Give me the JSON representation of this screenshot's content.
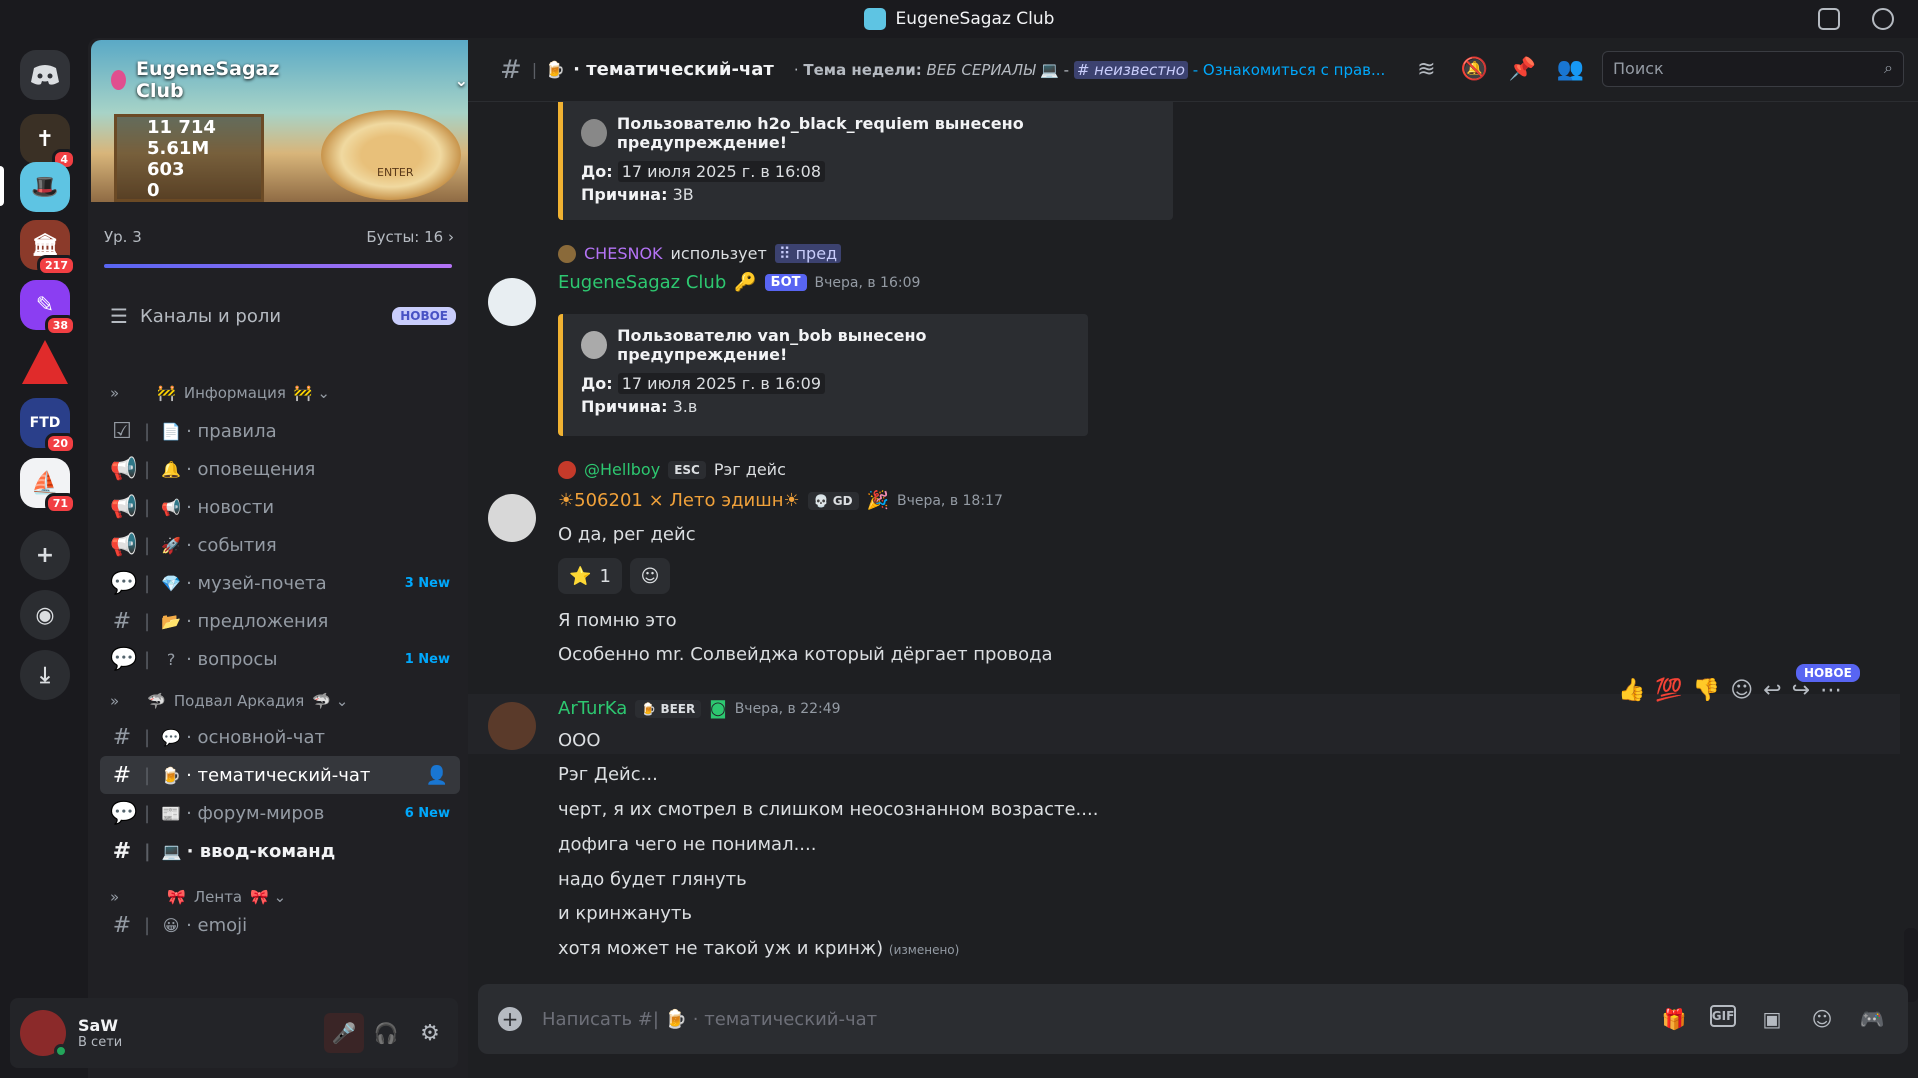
{
  "window": {
    "title": "EugeneSagaz Club"
  },
  "guilds": [
    {
      "badge": "4"
    },
    {
      "badge": ""
    },
    {
      "badge": "217"
    },
    {
      "badge": "38"
    },
    {
      "badge": ""
    },
    {
      "badge": "20"
    },
    {
      "badge": "71"
    }
  ],
  "server": {
    "name": "EugeneSagaz Club",
    "stats": [
      "11 714",
      "5.61M",
      "603",
      "0"
    ],
    "enter": "ENTER",
    "level": "Ур. 3",
    "boosts": "Бусты: 16",
    "channels_roles": "Каналы и роли",
    "new_label": "НОВОЕ"
  },
  "categories": [
    "Информация",
    "Подвал Аркадия",
    "Лента"
  ],
  "channels": [
    {
      "name": "правила",
      "emoji": "📄",
      "new": ""
    },
    {
      "name": "оповещения",
      "emoji": "🔔",
      "new": ""
    },
    {
      "name": "новости",
      "emoji": "📢",
      "new": ""
    },
    {
      "name": "события",
      "emoji": "🚀",
      "new": ""
    },
    {
      "name": "музей-почета",
      "emoji": "💎",
      "new": "3 New"
    },
    {
      "name": "предложения",
      "emoji": "📂",
      "new": ""
    },
    {
      "name": "вопросы",
      "emoji": "?",
      "new": "1 New"
    },
    {
      "name": "основной-чат",
      "emoji": "💬",
      "new": ""
    },
    {
      "name": "тематический-чат",
      "emoji": "🍺",
      "new": ""
    },
    {
      "name": "форум-миров",
      "emoji": "📰",
      "new": "6 New"
    },
    {
      "name": "ввод-команд",
      "emoji": "💻",
      "new": ""
    },
    {
      "name": "emoji",
      "emoji": "😀",
      "new": ""
    }
  ],
  "user": {
    "name": "SaW",
    "status": "В сети"
  },
  "header": {
    "channel": "тематический-чат",
    "topic_prefix": "Тема недели:",
    "topic_italic": "ВЕБ СЕРИАЛЫ",
    "topic_link": "# неизвестно",
    "topic_rest": "- Ознакомиться с прав...",
    "search_placeholder": "Поиск"
  },
  "messages": {
    "embed1": {
      "title": "Пользователю h2o_black_requiem вынесено предупреждение!",
      "until_label": "До:",
      "until": "17 июля 2025 г. в 16:08",
      "reason_label": "Причина:",
      "reason": "3В"
    },
    "reply1": {
      "user": "CHESNOK",
      "text": "использует",
      "cmd": "пред"
    },
    "msg1": {
      "author": "EugeneSagaz Club",
      "bot": "БОТ",
      "time": "Вчера, в 16:09"
    },
    "embed2": {
      "title": "Пользователю van_bob вынесено предупреждение!",
      "until_label": "До:",
      "until": "17 июля 2025 г. в 16:09",
      "reason_label": "Причина:",
      "reason": "3.в"
    },
    "reply2": {
      "user": "@Hellboy",
      "tag": "ESC",
      "text": "Рэг дейс"
    },
    "msg2": {
      "author": "☀506201 × Лето эдишн☀",
      "tag": "GD",
      "time": "Вчера, в 18:17",
      "text": "О да, рег дейс",
      "reaction_count": "1"
    },
    "msg2b": [
      "Я помню это",
      "Особенно mr. Солвейджа который дёргает провода"
    ],
    "msg3": {
      "author": "ArTurKa",
      "tag": "BEER",
      "time": "Вчера, в 22:49",
      "new_label": "НОВОЕ"
    },
    "msg3_lines": [
      "ООО",
      "Рэг Дейс...",
      "черт, я их смотрел в слишком неосознанном возрасте....",
      "дофига чего не понимал....",
      "надо будет глянуть",
      "и кринжануть",
      "хотя может не такой уж и кринж)"
    ],
    "edited": "(изменено)"
  },
  "composer": {
    "placeholder": "Написать #|",
    "channel": "тематический-чат",
    "gif": "GIF"
  },
  "colors": {
    "accent": "#5865f2",
    "embed_bar": "#f0b232",
    "bot_green": "#2dc770",
    "chesnok": "#b473f5",
    "hellboy": "#2dc770",
    "sun": "#f0a13a"
  }
}
